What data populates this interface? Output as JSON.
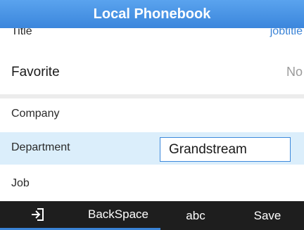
{
  "header": {
    "title": "Local Phonebook"
  },
  "fields": {
    "title": {
      "label": "Title",
      "value": "jobtitle"
    },
    "favorite": {
      "label": "Favorite",
      "value": "No"
    },
    "company": {
      "label": "Company"
    },
    "department": {
      "label": "Department",
      "value": "Grandstream"
    },
    "job": {
      "label": "Job"
    }
  },
  "softkeys": {
    "exit_icon": "exit-arrow-icon",
    "backspace_label": "BackSpace",
    "input_mode_label": "abc",
    "save_label": "Save"
  },
  "colors": {
    "header": "#4a97e8",
    "accent": "#3a83d6",
    "selected_row": "#dbeefb",
    "softkey_bar": "#1e1e1e"
  }
}
